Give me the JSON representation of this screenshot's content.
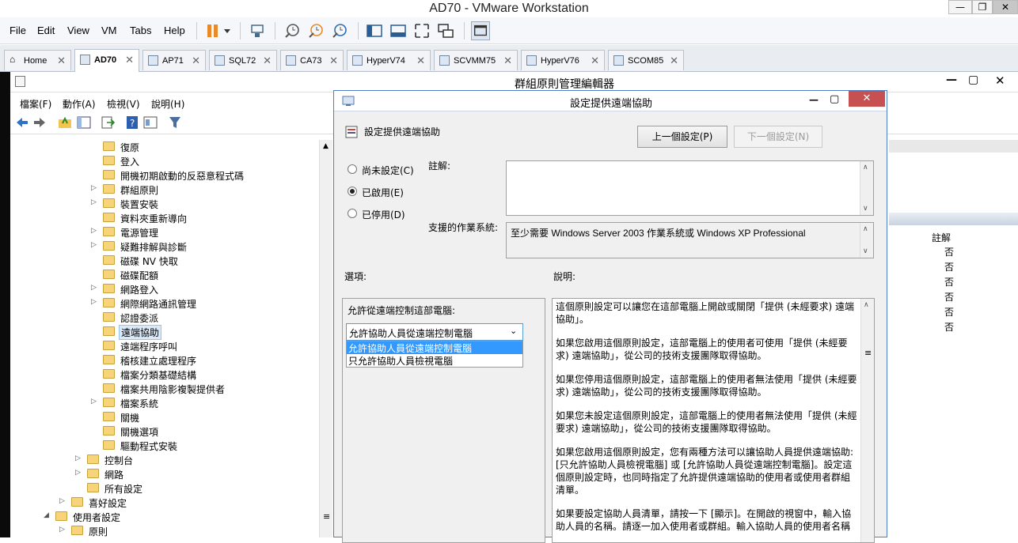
{
  "vmware": {
    "title": "AD70 - VMware Workstation",
    "menu": [
      "File",
      "Edit",
      "View",
      "VM",
      "Tabs",
      "Help"
    ],
    "tabs": [
      {
        "label": "Home",
        "icon": "home-icon"
      },
      {
        "label": "AD70",
        "icon": "vm-icon",
        "active": true
      },
      {
        "label": "AP71",
        "icon": "vm-icon"
      },
      {
        "label": "SQL72",
        "icon": "vm-icon"
      },
      {
        "label": "CA73",
        "icon": "vm-icon"
      },
      {
        "label": "HyperV74",
        "icon": "vm-icon"
      },
      {
        "label": "SCVMM75",
        "icon": "vm-icon"
      },
      {
        "label": "HyperV76",
        "icon": "vm-icon"
      },
      {
        "label": "SCOM85",
        "icon": "vm-icon"
      }
    ]
  },
  "gpme": {
    "title": "群組原則管理編輯器",
    "menu": [
      "檔案(F)",
      "動作(A)",
      "檢視(V)",
      "說明(H)"
    ],
    "tree": [
      {
        "label": "復原",
        "level": 3
      },
      {
        "label": "登入",
        "level": 3
      },
      {
        "label": "開機初期啟動的反惡意程式碼",
        "level": 3
      },
      {
        "label": "群組原則",
        "level": 3,
        "expandable": true
      },
      {
        "label": "裝置安裝",
        "level": 3,
        "expandable": true
      },
      {
        "label": "資料夾重新導向",
        "level": 3
      },
      {
        "label": "電源管理",
        "level": 3,
        "expandable": true
      },
      {
        "label": "疑難排解與診斷",
        "level": 3,
        "expandable": true
      },
      {
        "label": "磁碟 NV 快取",
        "level": 3
      },
      {
        "label": "磁碟配額",
        "level": 3
      },
      {
        "label": "網路登入",
        "level": 3,
        "expandable": true
      },
      {
        "label": "網際網路通訊管理",
        "level": 3,
        "expandable": true
      },
      {
        "label": "認證委派",
        "level": 3
      },
      {
        "label": "遠端協助",
        "level": 3,
        "selected": true
      },
      {
        "label": "遠端程序呼叫",
        "level": 3
      },
      {
        "label": "稽核建立處理程序",
        "level": 3
      },
      {
        "label": "檔案分類基礎結構",
        "level": 3
      },
      {
        "label": "檔案共用陰影複製提供者",
        "level": 3
      },
      {
        "label": "檔案系統",
        "level": 3,
        "expandable": true
      },
      {
        "label": "關機",
        "level": 3
      },
      {
        "label": "關機選項",
        "level": 3
      },
      {
        "label": "驅動程式安裝",
        "level": 3
      },
      {
        "label": "控制台",
        "level": 2,
        "expandable": true
      },
      {
        "label": "網路",
        "level": 2,
        "expandable": true
      },
      {
        "label": "所有設定",
        "level": 2
      },
      {
        "label": "喜好設定",
        "level": 1,
        "expandable": true
      },
      {
        "label": "使用者設定",
        "level": 0,
        "expanded": true
      },
      {
        "label": "原則",
        "level": 1,
        "expandable": true
      }
    ],
    "right_header": "註解",
    "right_values": [
      "否",
      "否",
      "否",
      "否",
      "否",
      "否"
    ]
  },
  "dialog": {
    "title": "設定提供遠端協助",
    "setting_name": "設定提供遠端協助",
    "prev_button": "上一個設定(P)",
    "next_button": "下一個設定(N)",
    "radio_not_configured": "尚未設定(C)",
    "radio_enabled": "已啟用(E)",
    "radio_disabled": "已停用(D)",
    "comment_label": "註解:",
    "supported_label": "支援的作業系統:",
    "supported_value": "至少需要 Windows Server 2003 作業系統或 Windows XP Professional",
    "options_label": "選項:",
    "help_label": "說明:",
    "option_title": "允許從遠端控制這部電腦:",
    "select_value": "允許協助人員從遠端控制電腦",
    "select_options": [
      "允許協助人員從遠端控制電腦",
      "只允許協助人員檢視電腦"
    ],
    "help_text": [
      "這個原則設定可以讓您在這部電腦上開啟或關閉「提供 (未經要求) 遠端協助」。",
      "如果您啟用這個原則設定，這部電腦上的使用者可使用「提供 (未經要求) 遠端協助」，從公司的技術支援團隊取得協助。",
      "如果您停用這個原則設定，這部電腦上的使用者無法使用「提供 (未經要求) 遠端協助」，從公司的技術支援團隊取得協助。",
      "如果您未設定這個原則設定，這部電腦上的使用者無法使用「提供 (未經要求) 遠端協助」，從公司的技術支援團隊取得協助。",
      "如果您啟用這個原則設定，您有兩種方法可以讓協助人員提供遠端協助: [只允許協助人員檢視電腦] 或 [允許協助人員從遠端控制電腦]。設定這個原則設定時，也同時指定了允許提供遠端協助的使用者或使用者群組清單。",
      "如果要設定協助人員清單，請按一下 [顯示]。在開啟的視窗中，輸入協助人員的名稱。請逐一加入使用者或群組。輸入協助人員的使用者名稱"
    ]
  }
}
